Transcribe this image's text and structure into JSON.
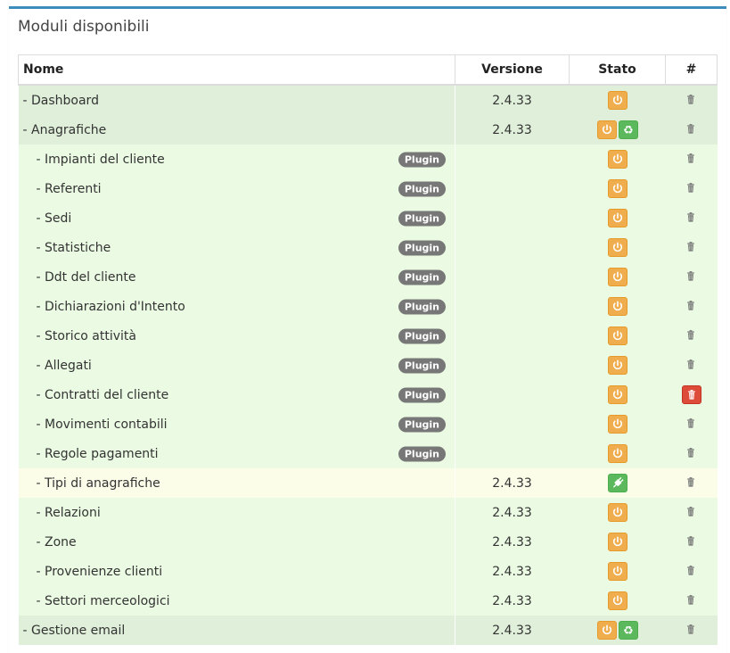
{
  "panel": {
    "title": "Moduli disponibili"
  },
  "table": {
    "headers": {
      "name": "Nome",
      "version": "Versione",
      "status": "Stato",
      "actions": "#"
    },
    "plugin_label": "Plugin",
    "rows": [
      {
        "name": "- Dashboard",
        "level": 0,
        "version": "2.4.33",
        "status": [
          "power"
        ],
        "delete_highlight": false
      },
      {
        "name": "- Anagrafiche",
        "level": 0,
        "version": "2.4.33",
        "status": [
          "power",
          "recycle"
        ],
        "delete_highlight": false
      },
      {
        "name": "- Impianti del cliente",
        "level": 1,
        "plugin": true,
        "version": "",
        "status": [
          "power"
        ],
        "delete_highlight": false
      },
      {
        "name": "- Referenti",
        "level": 1,
        "plugin": true,
        "version": "",
        "status": [
          "power"
        ],
        "delete_highlight": false
      },
      {
        "name": "- Sedi",
        "level": 1,
        "plugin": true,
        "version": "",
        "status": [
          "power"
        ],
        "delete_highlight": false
      },
      {
        "name": "- Statistiche",
        "level": 1,
        "plugin": true,
        "version": "",
        "status": [
          "power"
        ],
        "delete_highlight": false
      },
      {
        "name": "- Ddt del cliente",
        "level": 1,
        "plugin": true,
        "version": "",
        "status": [
          "power"
        ],
        "delete_highlight": false
      },
      {
        "name": "- Dichiarazioni d'Intento",
        "level": 1,
        "plugin": true,
        "version": "",
        "status": [
          "power"
        ],
        "delete_highlight": false
      },
      {
        "name": "- Storico attività",
        "level": 1,
        "plugin": true,
        "version": "",
        "status": [
          "power"
        ],
        "delete_highlight": false
      },
      {
        "name": "- Allegati",
        "level": 1,
        "plugin": true,
        "version": "",
        "status": [
          "power"
        ],
        "delete_highlight": false
      },
      {
        "name": "- Contratti del cliente",
        "level": 1,
        "plugin": true,
        "version": "",
        "status": [
          "power"
        ],
        "delete_highlight": true
      },
      {
        "name": "- Movimenti contabili",
        "level": 1,
        "plugin": true,
        "version": "",
        "status": [
          "power"
        ],
        "delete_highlight": false
      },
      {
        "name": "- Regole pagamenti",
        "level": 1,
        "plugin": true,
        "version": "",
        "status": [
          "power"
        ],
        "delete_highlight": false
      },
      {
        "name": "- Tipi di anagrafiche",
        "level": 1,
        "disabled": true,
        "version": "2.4.33",
        "status": [
          "plug"
        ],
        "delete_highlight": false
      },
      {
        "name": "- Relazioni",
        "level": 1,
        "version": "2.4.33",
        "status": [
          "power"
        ],
        "delete_highlight": false
      },
      {
        "name": "- Zone",
        "level": 1,
        "version": "2.4.33",
        "status": [
          "power"
        ],
        "delete_highlight": false
      },
      {
        "name": "- Provenienze clienti",
        "level": 1,
        "version": "2.4.33",
        "status": [
          "power"
        ],
        "delete_highlight": false
      },
      {
        "name": "- Settori merceologici",
        "level": 1,
        "version": "2.4.33",
        "status": [
          "power"
        ],
        "delete_highlight": false
      },
      {
        "name": "- Gestione email",
        "level": 0,
        "version": "2.4.33",
        "status": [
          "power",
          "recycle"
        ],
        "delete_highlight": false
      }
    ]
  },
  "colors": {
    "accent": "#3c8dbc",
    "warning": "#f0ad4e",
    "success": "#5cb85c",
    "danger": "#dd4b39",
    "row_parent": "#dfefd9",
    "row_child": "#ebfbe3",
    "row_disabled": "#fbfde9"
  },
  "icons": {
    "power": "power-icon",
    "recycle": "recycle-icon",
    "plug": "plug-icon",
    "trash": "trash-icon"
  }
}
